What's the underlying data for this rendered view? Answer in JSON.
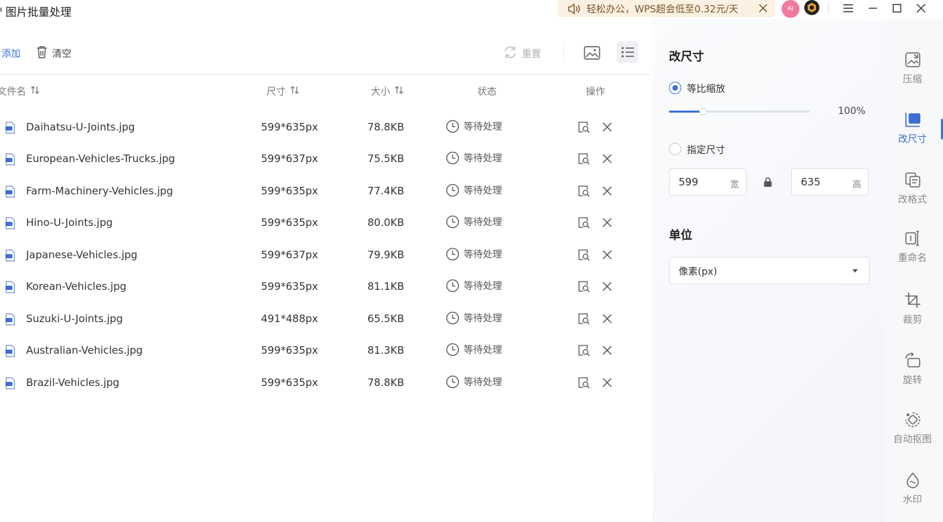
{
  "app": {
    "title": "图片批量处理"
  },
  "promo": {
    "text": "轻松办公，WPS超会低至0.32元/天"
  },
  "avatar": {
    "ai_label": "AI"
  },
  "toolbar": {
    "add_label": "添加",
    "clear_label": "清空",
    "reset_label": "重置"
  },
  "table": {
    "headers": {
      "filename": "文件名",
      "dimensions": "尺寸",
      "size": "大小",
      "status": "状态",
      "actions": "操作"
    },
    "rows": [
      {
        "name": "Daihatsu-U-Joints.jpg",
        "dim": "599*635px",
        "size": "78.8KB",
        "status": "等待处理"
      },
      {
        "name": "European-Vehicles-Trucks.jpg",
        "dim": "599*637px",
        "size": "75.5KB",
        "status": "等待处理"
      },
      {
        "name": "Farm-Machinery-Vehicles.jpg",
        "dim": "599*635px",
        "size": "77.4KB",
        "status": "等待处理"
      },
      {
        "name": "Hino-U-Joints.jpg",
        "dim": "599*635px",
        "size": "80.0KB",
        "status": "等待处理"
      },
      {
        "name": "Japanese-Vehicles.jpg",
        "dim": "599*637px",
        "size": "79.9KB",
        "status": "等待处理"
      },
      {
        "name": "Korean-Vehicles.jpg",
        "dim": "599*635px",
        "size": "81.1KB",
        "status": "等待处理"
      },
      {
        "name": "Suzuki-U-Joints.jpg",
        "dim": "491*488px",
        "size": "65.5KB",
        "status": "等待处理"
      },
      {
        "name": "Australian-Vehicles.jpg",
        "dim": "599*635px",
        "size": "81.3KB",
        "status": "等待处理"
      },
      {
        "name": "Brazil-Vehicles.jpg",
        "dim": "599*635px",
        "size": "78.8KB",
        "status": "等待处理"
      }
    ]
  },
  "resize_panel": {
    "title": "改尺寸",
    "proportional_label": "等比缩放",
    "proportional_selected": true,
    "scale_percent_text": "100%",
    "slider_fraction": 0.24,
    "specify_label": "指定尺寸",
    "specify_selected": false,
    "width_value": "599",
    "width_unit": "宽",
    "height_value": "635",
    "height_unit": "高",
    "unit_title": "单位",
    "unit_selected": "像素(px)"
  },
  "nav": {
    "items": [
      {
        "label": "压缩",
        "icon": "compress-icon",
        "active": false
      },
      {
        "label": "改尺寸",
        "icon": "resize-icon",
        "active": true
      },
      {
        "label": "改格式",
        "icon": "convert-format-icon",
        "active": false
      },
      {
        "label": "重命名",
        "icon": "rename-icon",
        "active": false
      },
      {
        "label": "裁剪",
        "icon": "crop-icon",
        "active": false
      },
      {
        "label": "旋转",
        "icon": "rotate-icon",
        "active": false
      },
      {
        "label": "自动抠图",
        "icon": "auto-cutout-icon",
        "active": false
      },
      {
        "label": "水印",
        "icon": "watermark-icon",
        "active": false
      }
    ]
  },
  "colors": {
    "accent": "#3b6fd6",
    "promo_bg": "#fbf1e3",
    "promo_text": "#7a5428",
    "avatar_ai": "#f07a9e"
  }
}
